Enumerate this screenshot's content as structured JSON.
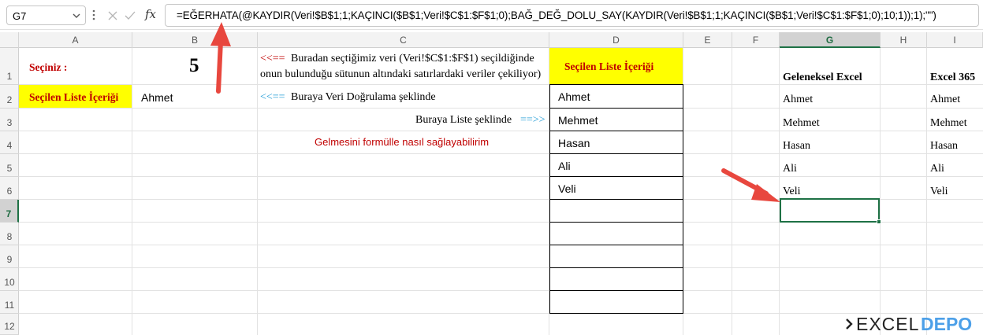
{
  "formula_bar": {
    "name_box": "G7",
    "fx_label": "fx",
    "formula": "=EĞERHATA(@KAYDIR(Veri!$B$1;1;KAÇINCI($B$1;Veri!$C$1:$F$1;0);BAĞ_DEĞ_DOLU_SAY(KAYDIR(Veri!$B$1;1;KAÇINCI($B$1;Veri!$C$1:$F$1;0);10;1));1);\"\")"
  },
  "columns": [
    "A",
    "B",
    "C",
    "D",
    "E",
    "F",
    "G",
    "H",
    "I"
  ],
  "rows": [
    "1",
    "2",
    "3",
    "4",
    "5",
    "6",
    "7",
    "8",
    "9",
    "10",
    "11",
    "12"
  ],
  "active_cell": {
    "column": "G",
    "row": "7"
  },
  "cells": {
    "a1": "Seçiniz :",
    "b1": "5",
    "a2": "Seçilen Liste İçeriği",
    "b2": "Ahmet",
    "c1_arrow": "<<==",
    "c1_line1": "Buradan seçtiğimiz veri (Veri!$C$1:$F$1) seçildiğinde",
    "c1_line2": "onun bulunduğu sütunun altındaki satırlardaki veriler çekiliyor)",
    "c2_arrow": "<<==",
    "c2_text": "Buraya Veri Doğrulama şeklinde",
    "c3_text": "Buraya Liste şeklinde",
    "c3_arrow": "==>>",
    "c4_text": "Gelmesini formülle nasıl sağlayabilirim",
    "d1": "Seçilen Liste İçeriği",
    "g1": "Geleneksel Excel",
    "i1": "Excel 365"
  },
  "d_list": [
    "Ahmet",
    "Mehmet",
    "Hasan",
    "Ali",
    "Veli",
    "",
    "",
    "",
    "",
    ""
  ],
  "g_list": [
    "Ahmet",
    "Mehmet",
    "Hasan",
    "Ali",
    "Veli"
  ],
  "i_list": [
    "Ahmet",
    "Mehmet",
    "Hasan",
    "Ali",
    "Veli"
  ],
  "logo": {
    "part1": "EXCEL",
    "part2": "DEPO"
  },
  "colors": {
    "yellow_fill": "#ffff00",
    "red_text": "#c00000",
    "c3_arrow_color": "#1f9bd6",
    "c4_text_color": "#c00000",
    "selection_green": "#1e7145",
    "annotation_arrow": "#e8473e"
  }
}
